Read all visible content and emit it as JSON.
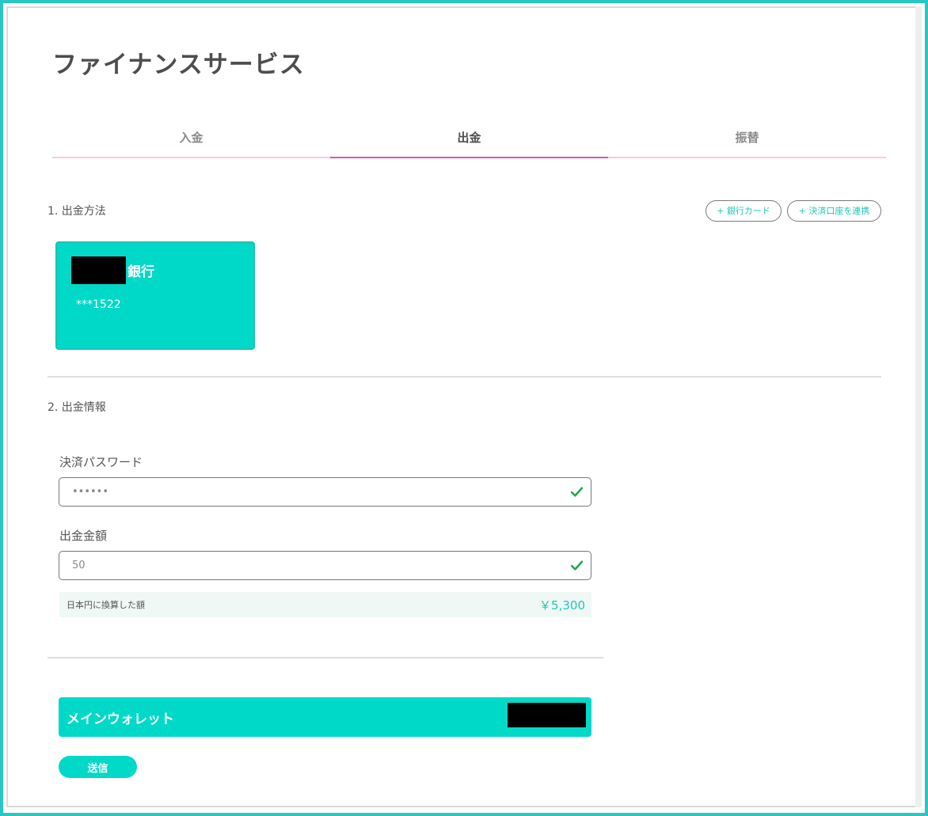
{
  "page": {
    "title": "ファイナンスサービス"
  },
  "tabs": [
    {
      "label": "入金",
      "active": false
    },
    {
      "label": "出金",
      "active": true
    },
    {
      "label": "振替",
      "active": false
    }
  ],
  "method_section": {
    "label": "1. 出金方法",
    "add_bank_card_label": "+ 銀行カード",
    "link_account_label": "+ 決済口座を連携",
    "card": {
      "bank_suffix": "銀行",
      "number": "***1522"
    }
  },
  "info_section": {
    "label": "2. 出金情報",
    "password_label": "決済パスワード",
    "password_value": "••••••",
    "amount_label": "出金金額",
    "amount_value": "50",
    "conversion_label": "日本円に換算した額",
    "conversion_value": "￥5,300"
  },
  "wallet": {
    "label": "メインウォレット"
  },
  "submit": {
    "label": "送信"
  },
  "colors": {
    "accent": "#00d9c8",
    "tab_active_underline": "#e0559c",
    "tab_underline": "#f7c9e1",
    "check": "#22a84a"
  },
  "icons": {
    "field_valid": "check-icon"
  }
}
